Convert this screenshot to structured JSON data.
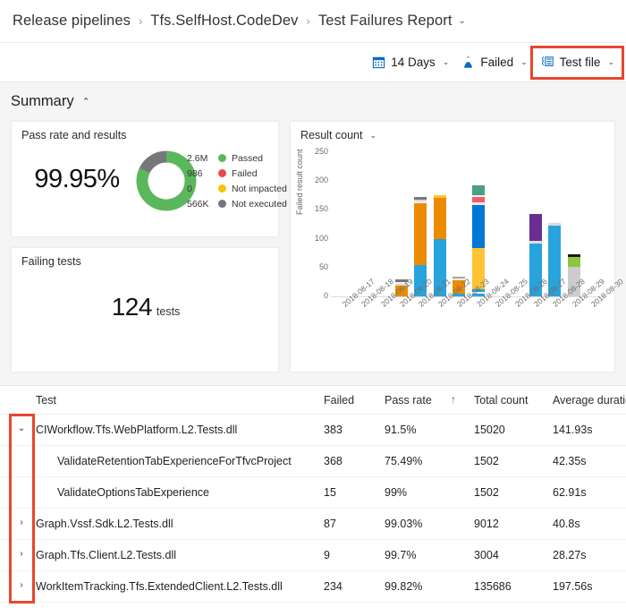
{
  "breadcrumb": {
    "items": [
      "Release pipelines",
      "Tfs.SelfHost.CodeDev",
      "Test Failures Report"
    ],
    "separator": "›",
    "caret": "⌄"
  },
  "toolbar": {
    "items": [
      {
        "icon": "calendar-icon",
        "label": "14 Days",
        "caret": "⌄",
        "highlighted": false
      },
      {
        "icon": "flask-icon",
        "label": "Failed",
        "caret": "⌄",
        "highlighted": false
      },
      {
        "icon": "group-by-icon",
        "label": "Test file",
        "caret": "⌄",
        "highlighted": true
      }
    ],
    "highlight_color": "#e8462f"
  },
  "summary": {
    "title": "Summary",
    "collapse_caret": "⌃"
  },
  "pass_rate_card": {
    "title": "Pass rate and results",
    "percent": "99.95%",
    "donut": {
      "segments": [
        {
          "label": "Passed",
          "fraction": 0.82,
          "color": "#5BB75B"
        },
        {
          "label": "Not executed",
          "fraction": 0.18,
          "color": "#77777A"
        }
      ]
    },
    "legend": [
      {
        "value": "2.6M",
        "label": "Passed",
        "color": "#5BB75B"
      },
      {
        "value": "986",
        "label": "Failed",
        "color": "#E8484A"
      },
      {
        "value": "0",
        "label": "Not impacted",
        "color": "#F6C400"
      },
      {
        "value": "566K",
        "label": "Not executed",
        "color": "#77777A"
      }
    ]
  },
  "failing_tests_card": {
    "title": "Failing tests",
    "value": "124",
    "unit": "tests"
  },
  "chart_card": {
    "title": "Result count",
    "caret": "⌄"
  },
  "chart_data": {
    "type": "bar",
    "title": "Result count",
    "subtitle": "",
    "stacked": true,
    "xlabel": "",
    "ylabel": "Failed result count",
    "ylim": [
      0,
      250
    ],
    "yticks": [
      0,
      50,
      100,
      150,
      200,
      250
    ],
    "grid": false,
    "legend_position": "none",
    "categories": [
      "2018-08-17",
      "2018-08-18",
      "2018-08-19",
      "2018-08-20",
      "2018-08-21",
      "2018-08-22",
      "2018-08-23",
      "2018-08-24",
      "2018-08-25",
      "2018-08-26",
      "2018-08-27",
      "2018-08-28",
      "2018-08-29",
      "2018-08-30"
    ],
    "totals": [
      0,
      0,
      0,
      29,
      172,
      175,
      35,
      192,
      0,
      0,
      143,
      128,
      73,
      0
    ],
    "stacks": [
      {
        "category": "2018-08-17",
        "segments": []
      },
      {
        "category": "2018-08-18",
        "segments": []
      },
      {
        "category": "2018-08-19",
        "segments": []
      },
      {
        "category": "2018-08-20",
        "segments": [
          {
            "value": 19,
            "color": "#ED8B00"
          },
          {
            "value": 3,
            "color": "#D9D9D9"
          },
          {
            "value": 3,
            "color": "#F2F2F2"
          },
          {
            "value": 4,
            "color": "#77777A"
          }
        ]
      },
      {
        "category": "2018-08-21",
        "segments": [
          {
            "value": 55,
            "color": "#29A3DC"
          },
          {
            "value": 107,
            "color": "#ED8B00"
          },
          {
            "value": 3,
            "color": "#F2F2F2"
          },
          {
            "value": 3,
            "color": "#D9D9D9"
          },
          {
            "value": 4,
            "color": "#77777A"
          }
        ]
      },
      {
        "category": "2018-08-22",
        "segments": [
          {
            "value": 100,
            "color": "#29A3DC"
          },
          {
            "value": 71,
            "color": "#ED8B00"
          },
          {
            "value": 4,
            "color": "#FFC333"
          }
        ]
      },
      {
        "category": "2018-08-23",
        "segments": [
          {
            "value": 4,
            "color": "#29A3DC"
          },
          {
            "value": 24,
            "color": "#ED8B00"
          },
          {
            "value": 3,
            "color": "#F2F2F2"
          },
          {
            "value": 4,
            "color": "#A6A6A6"
          }
        ]
      },
      {
        "category": "2018-08-24",
        "segments": [
          {
            "value": 5,
            "color": "#29A3DC"
          },
          {
            "value": 3,
            "color": "#F2F2F2"
          },
          {
            "value": 4,
            "color": "#29A3DC"
          },
          {
            "value": 72,
            "color": "#FFC333"
          },
          {
            "value": 74,
            "color": "#0078D4"
          },
          {
            "value": 5,
            "color": "#E8E8E8"
          },
          {
            "value": 10,
            "color": "#F25C6E"
          },
          {
            "value": 3,
            "color": "#F2F2F2"
          },
          {
            "value": 16,
            "color": "#4B9E7F"
          }
        ]
      },
      {
        "category": "2018-08-25",
        "segments": []
      },
      {
        "category": "2018-08-26",
        "segments": []
      },
      {
        "category": "2018-08-27",
        "segments": [
          {
            "value": 92,
            "color": "#29A3DC"
          },
          {
            "value": 5,
            "color": "#E0E0E0"
          },
          {
            "value": 46,
            "color": "#6B2D90"
          }
        ]
      },
      {
        "category": "2018-08-28",
        "segments": [
          {
            "value": 122,
            "color": "#29A3DC"
          },
          {
            "value": 6,
            "color": "#D9D9D9"
          }
        ]
      },
      {
        "category": "2018-08-29",
        "segments": [
          {
            "value": 52,
            "color": "#CCCCCC"
          },
          {
            "value": 16,
            "color": "#8CC63E"
          },
          {
            "value": 5,
            "color": "#1A1A1A"
          }
        ]
      },
      {
        "category": "2018-08-30",
        "segments": []
      }
    ]
  },
  "table": {
    "columns": [
      {
        "key": "test",
        "label": "Test"
      },
      {
        "key": "failed",
        "label": "Failed"
      },
      {
        "key": "pass",
        "label": "Pass rate"
      },
      {
        "key": "total",
        "label": "Total count"
      },
      {
        "key": "dur",
        "label": "Average duration"
      }
    ],
    "sort_indicator": "↑",
    "sorted_column": "Pass rate",
    "rows": [
      {
        "expander": "⌄",
        "level": 0,
        "test": "CIWorkflow.Tfs.WebPlatform.L2.Tests.dll",
        "failed": "383",
        "pass": "91.5%",
        "total": "15020",
        "dur": "141.93s"
      },
      {
        "expander": "",
        "level": 1,
        "test": "ValidateRetentionTabExperienceForTfvcProject",
        "failed": "368",
        "pass": "75.49%",
        "total": "1502",
        "dur": "42.35s"
      },
      {
        "expander": "",
        "level": 1,
        "test": "ValidateOptionsTabExperience",
        "failed": "15",
        "pass": "99%",
        "total": "1502",
        "dur": "62.91s"
      },
      {
        "expander": "›",
        "level": 0,
        "test": "Graph.Vssf.Sdk.L2.Tests.dll",
        "failed": "87",
        "pass": "99.03%",
        "total": "9012",
        "dur": "40.8s"
      },
      {
        "expander": "›",
        "level": 0,
        "test": "Graph.Tfs.Client.L2.Tests.dll",
        "failed": "9",
        "pass": "99.7%",
        "total": "3004",
        "dur": "28.27s"
      },
      {
        "expander": "›",
        "level": 0,
        "test": "WorkItemTracking.Tfs.ExtendedClient.L2.Tests.dll",
        "failed": "234",
        "pass": "99.82%",
        "total": "135686",
        "dur": "197.56s"
      }
    ]
  }
}
